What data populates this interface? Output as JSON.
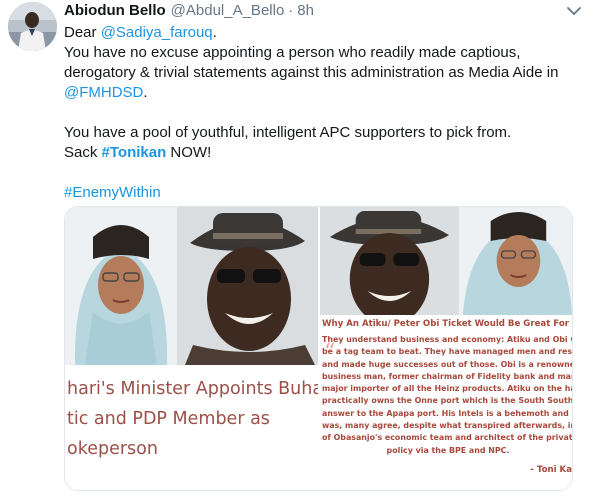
{
  "tweet": {
    "author_name": "Abiodun Bello",
    "author_handle": "@Abdul_A_Bello",
    "separator": "·",
    "time": "8h",
    "line1_prefix": "Dear ",
    "mention1": "@Sadiya_farouq",
    "line1_suffix": ".",
    "line2": "You have no excuse appointing a person who readily made captious,",
    "line3": "derogatory & trivial statements against this administration as Media Aide in",
    "mention2": "@FMHDSD",
    "line4_suffix": ".",
    "line5": "You have a pool of youthful, intelligent APC supporters to pick from.",
    "line6_prefix": "Sack ",
    "hashtag1": "#Tonikan",
    "line6_suffix": " NOW!",
    "hashtag2": "#EnemyWithin"
  },
  "media": {
    "left_caption": [
      "hari's Minister Appoints Buhari",
      "tic and PDP Member as",
      "okeperson"
    ],
    "right_title": "Why An Atiku/ Peter Obi Ticket Would Be Great For Niger",
    "right_body": [
      "They understand business and economy: Atiku and Obi wou",
      "be a tag team to beat. They have managed men and resourc",
      "and made huge successes out of those. Obi is a renowned",
      "business man, former chairman of Fidelity bank and many s",
      "major importer of all the Heinz products. Atiku on the han",
      "practically owns the Onne port which is the South South'",
      "answer to the Apapa port. His Intels is a behemoth and he",
      "was, many agree, despite what transpired afterwards, in cha",
      "of Obasanjo's economic team and architect of the privatizat",
      "policy via the BPE and NPC."
    ],
    "signature": "- Toni Ka",
    "quote_mark": "“"
  },
  "colors": {
    "link": "#1b95e0",
    "caption_left": "#9b5149",
    "caption_right": "#a8493b",
    "muted": "#657786"
  },
  "icons": {
    "menu": "chevron-down-icon"
  }
}
